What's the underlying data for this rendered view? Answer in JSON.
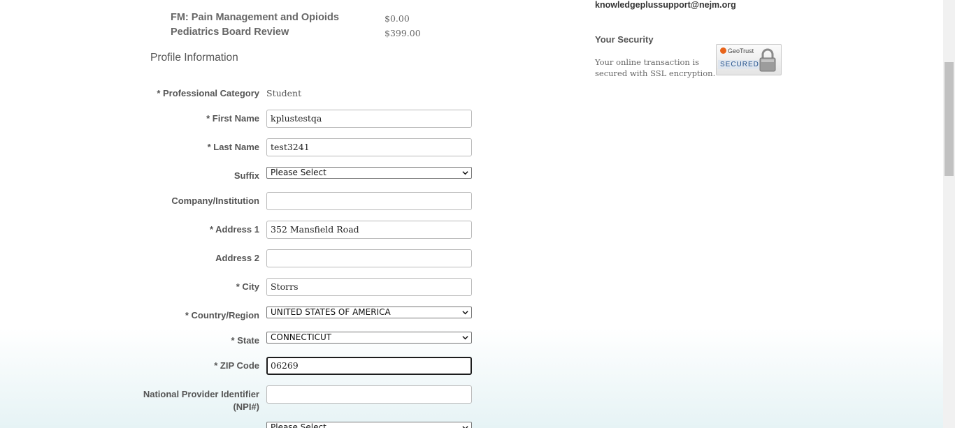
{
  "cart": {
    "items": [
      {
        "name": "FM: Pain Management and Opioids",
        "price": "$0.00"
      },
      {
        "name": "Pediatrics Board Review",
        "price": "$399.00"
      }
    ]
  },
  "profile": {
    "title": "Profile Information",
    "professional_category": {
      "label": "* Professional Category",
      "value": "Student"
    },
    "first_name": {
      "label": "* First Name",
      "value": "kplustestqa"
    },
    "last_name": {
      "label": "* Last Name",
      "value": "test3241"
    },
    "suffix": {
      "label": "Suffix",
      "value": "Please Select"
    },
    "company": {
      "label": "Company/Institution",
      "value": ""
    },
    "address1": {
      "label": "* Address 1",
      "value": "352 Mansfield Road"
    },
    "address2": {
      "label": "Address 2",
      "value": ""
    },
    "city": {
      "label": "* City",
      "value": "Storrs"
    },
    "country": {
      "label": "* Country/Region",
      "value": "UNITED STATES OF AMERICA"
    },
    "state": {
      "label": "* State",
      "value": "CONNECTICUT"
    },
    "zip": {
      "label": "* ZIP Code",
      "value": "06269"
    },
    "npi": {
      "label_line1": "National Provider Identifier",
      "label_line2": "(NPI#)",
      "value": ""
    },
    "next_select": {
      "value": "Please Select"
    }
  },
  "sidebar": {
    "support_email": "knowledgeplussupport@nejm.org",
    "security_title": "Your Security",
    "security_text": "Your online transaction is secured with SSL encryption.",
    "badge": {
      "brand": "GeoTrust",
      "label": "SECURED"
    }
  },
  "icons": {
    "select_arrow": "chevron-down-icon",
    "lock": "lock-icon"
  }
}
